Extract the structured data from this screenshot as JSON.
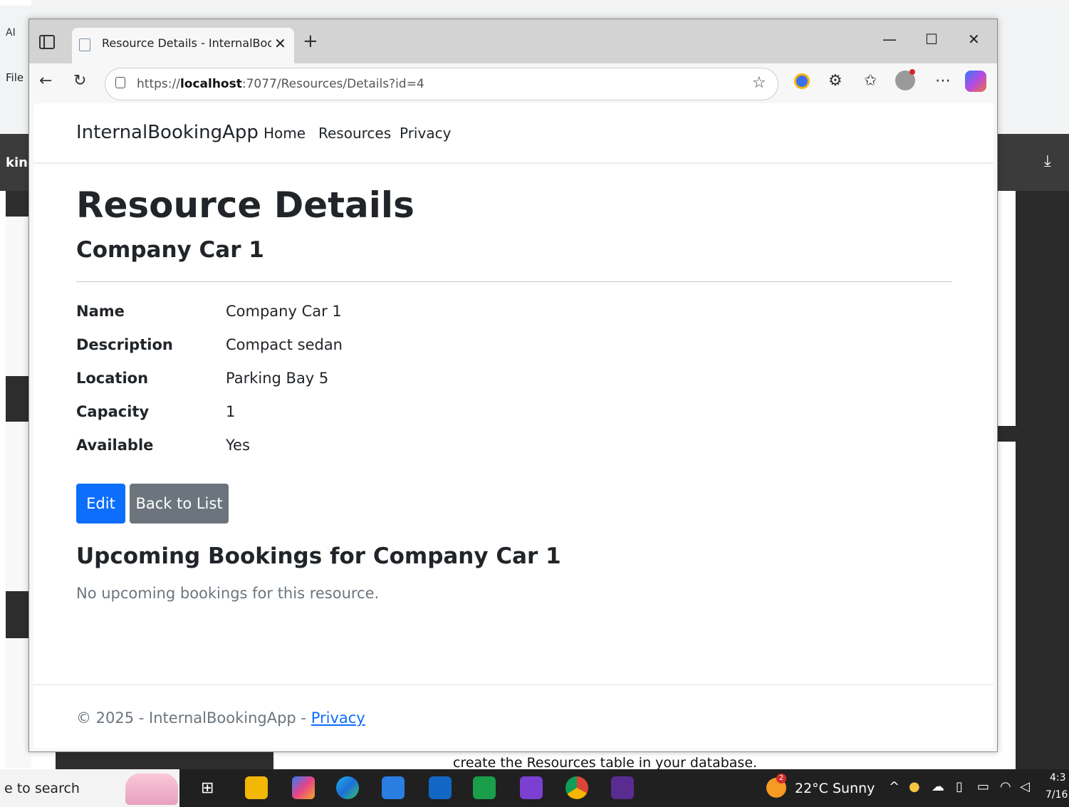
{
  "background": {
    "app_title": "AI",
    "file_label": "File",
    "dark_band_label": "king",
    "bottom_text": "create the Resources table in your database."
  },
  "browser": {
    "tab_title": "Resource Details - InternalBookingApp",
    "url_prefix": "https://",
    "url_host": "localhost",
    "url_rest": ":7077/Resources/Details?id=4"
  },
  "page": {
    "brand": "InternalBookingApp",
    "nav": [
      "Home",
      "Resources",
      "Privacy"
    ],
    "title": "Resource Details",
    "resource_name": "Company Car 1",
    "details": [
      {
        "label": "Name",
        "value": "Company Car 1"
      },
      {
        "label": "Description",
        "value": "Compact sedan"
      },
      {
        "label": "Location",
        "value": "Parking Bay 5"
      },
      {
        "label": "Capacity",
        "value": "1"
      },
      {
        "label": "Available",
        "value": "Yes"
      }
    ],
    "edit_label": "Edit",
    "back_label": "Back to List",
    "bookings_heading": "Upcoming Bookings for Company Car 1",
    "no_bookings": "No upcoming bookings for this resource.",
    "footer_text": "© 2025 - InternalBookingApp - ",
    "footer_link": "Privacy"
  },
  "taskbar": {
    "search_text": "e to search",
    "weather_badge": "2",
    "weather": "22°C  Sunny",
    "clock_time": "4:3",
    "clock_date": "7/16"
  },
  "colors": {
    "primary": "#0d6efd",
    "secondary": "#6c757d"
  }
}
